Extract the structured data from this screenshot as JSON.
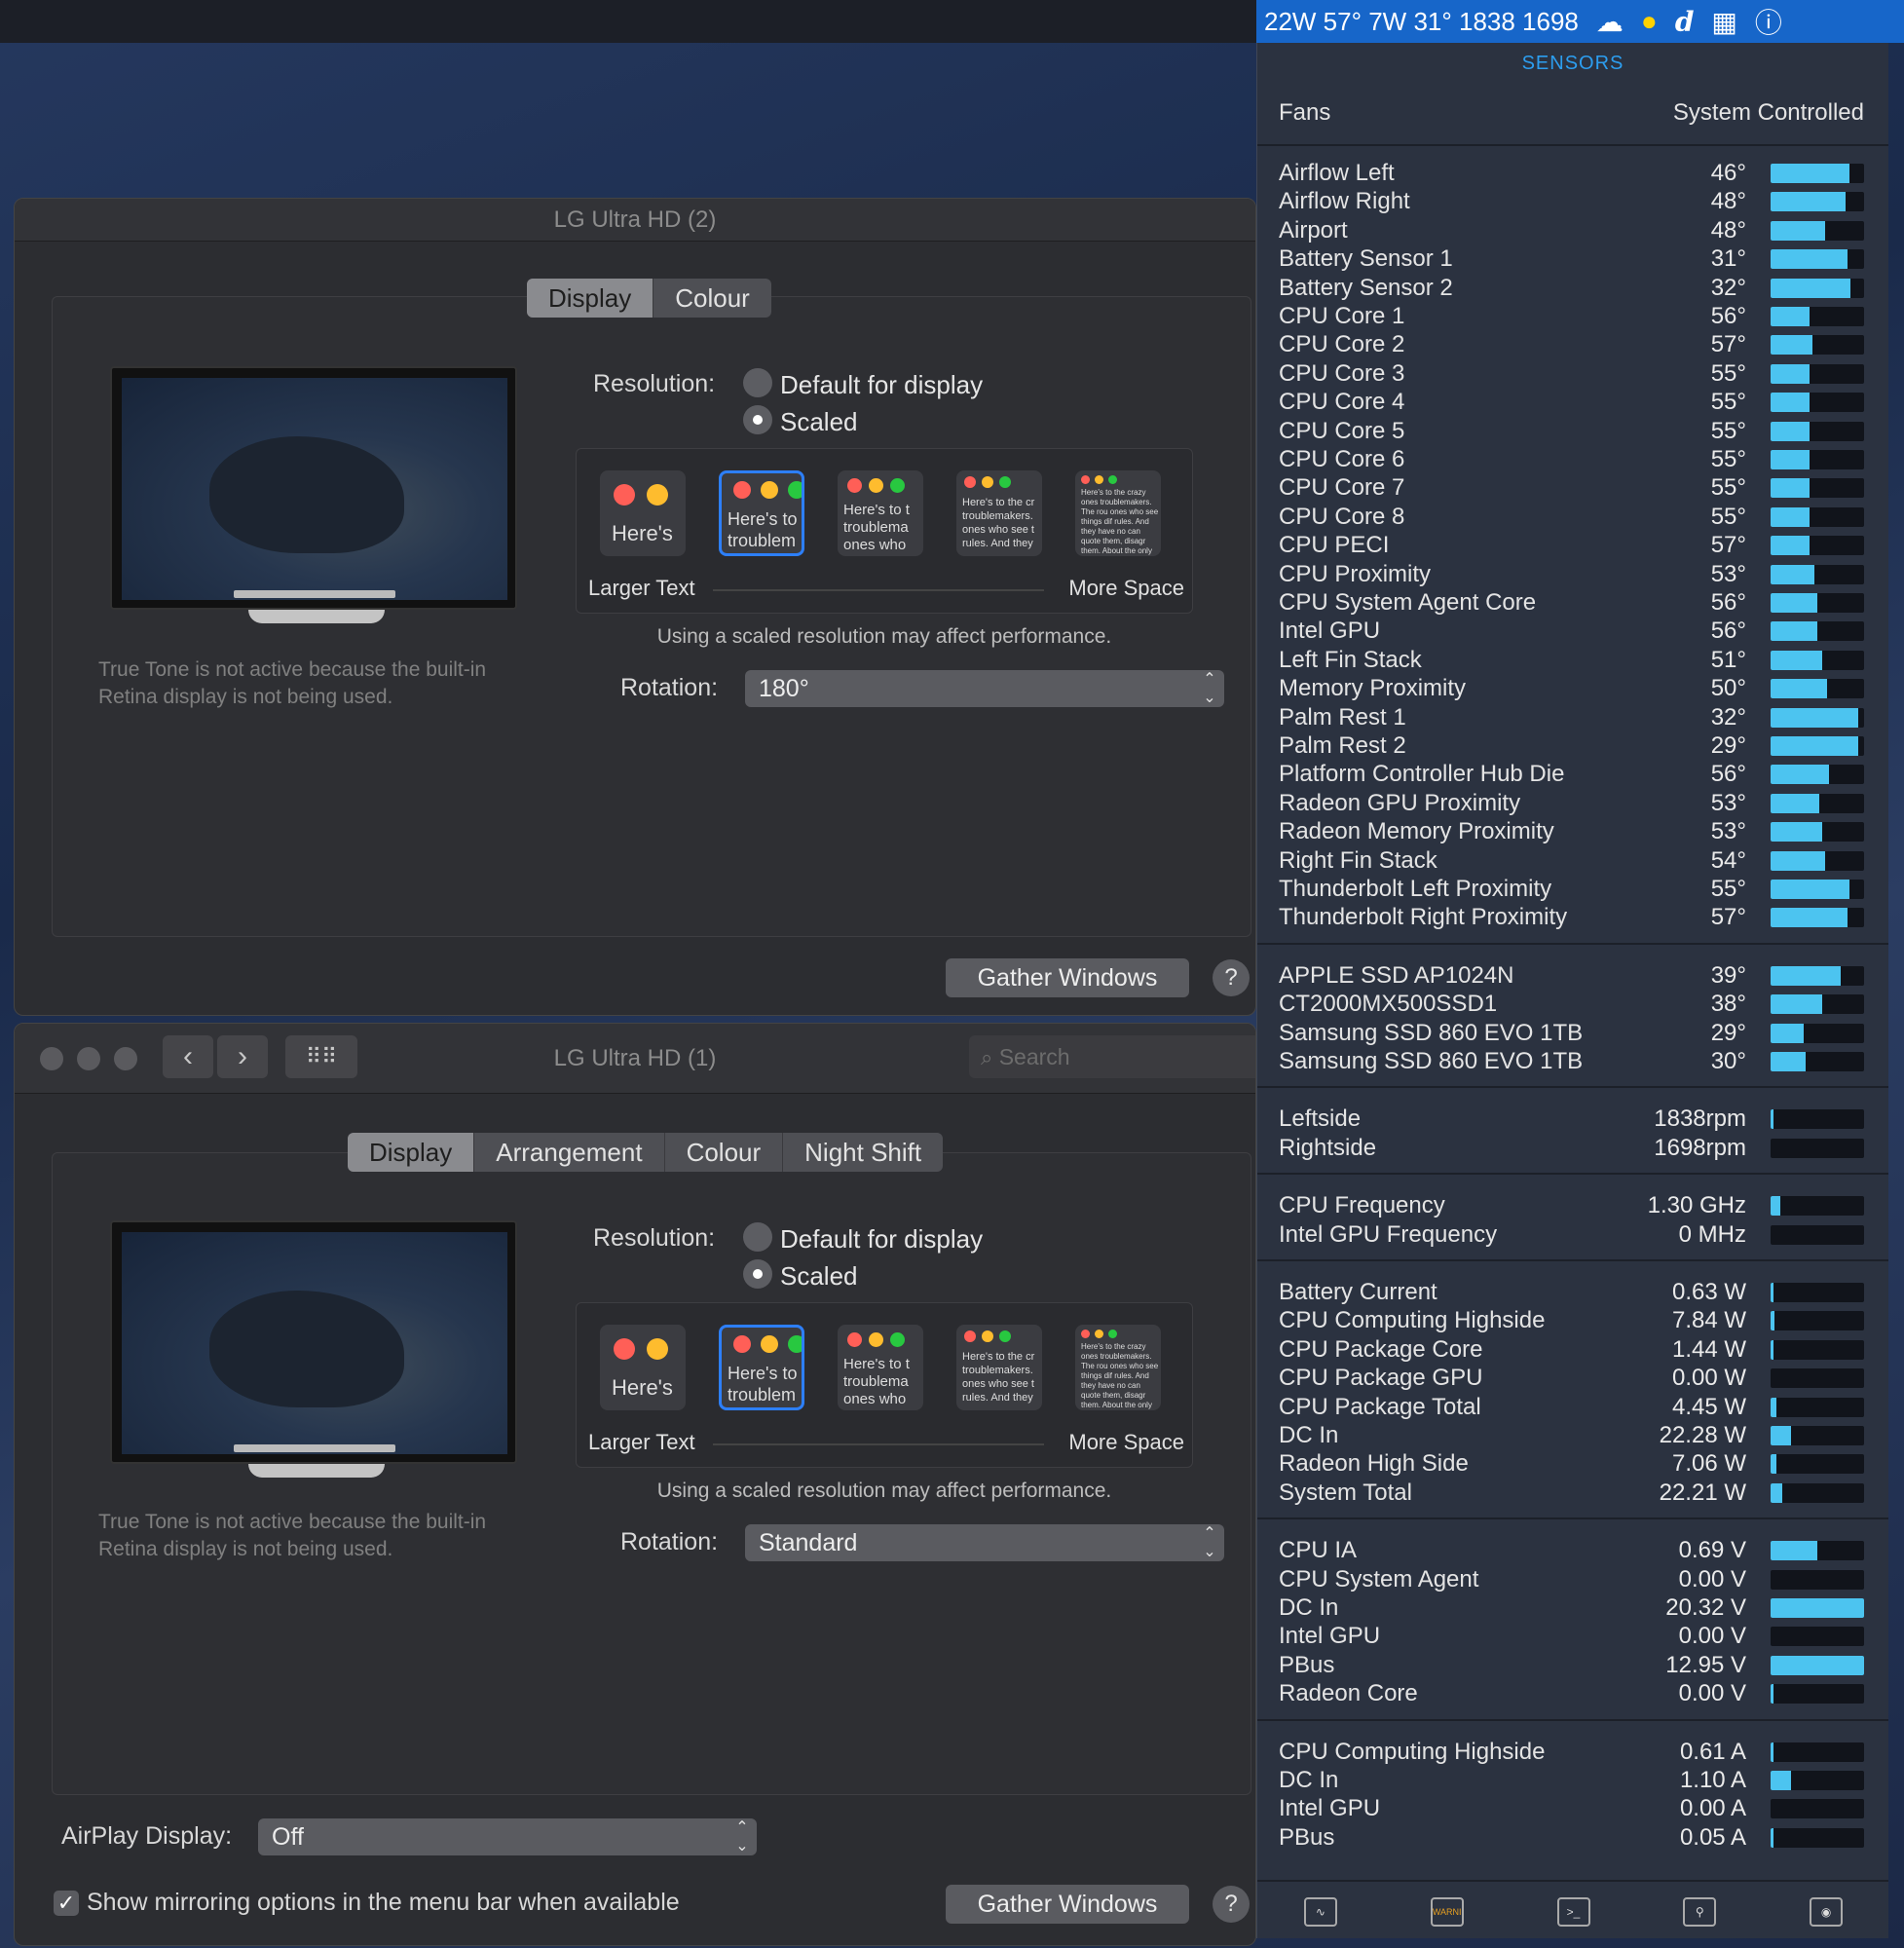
{
  "menubar": {
    "status_text": "22W 57° 7W   31° 1838 1698",
    "icons": [
      "cloud-icon",
      "yellow-circle-icon",
      "dictionary-icon",
      "grid-icon",
      "bolt-icon"
    ]
  },
  "win2": {
    "title": "LG Ultra HD (2)",
    "tabs": [
      {
        "label": "Display",
        "selected": true
      },
      {
        "label": "Colour",
        "selected": false
      }
    ],
    "resolution_label": "Resolution:",
    "option_default": "Default for display",
    "option_scaled": "Scaled",
    "thumb_texts": [
      "Here's",
      "Here's to troublem",
      "Here's to t troublema ones who",
      "Here's to the cr troublemakers. ones who see t rules. And they",
      "Here's to the crazy ones troublemakers. The rou ones who see things dif rules. And they have no can quote them, disagr them. About the only th Because they change it"
    ],
    "larger_text": "Larger Text",
    "more_space": "More Space",
    "performance_note": "Using a scaled resolution may affect performance.",
    "rotation_label": "Rotation:",
    "rotation_value": "180°",
    "truetone_note": "True Tone is not active because the built-in Retina display is not being used.",
    "gather_button": "Gather Windows",
    "help": "?"
  },
  "win1": {
    "title": "LG Ultra HD (1)",
    "search_placeholder": "Search",
    "tabs": [
      {
        "label": "Display",
        "selected": true
      },
      {
        "label": "Arrangement",
        "selected": false
      },
      {
        "label": "Colour",
        "selected": false
      },
      {
        "label": "Night Shift",
        "selected": false
      }
    ],
    "resolution_label": "Resolution:",
    "option_default": "Default for display",
    "option_scaled": "Scaled",
    "thumb_texts": [
      "Here's",
      "Here's to troublem",
      "Here's to t troublema ones who",
      "Here's to the cr troublemakers. ones who see t rules. And they",
      "Here's to the crazy ones troublemakers. The rou ones who see things dif rules. And they have no can quote them, disagr them. About the only th Because they change it"
    ],
    "larger_text": "Larger Text",
    "more_space": "More Space",
    "performance_note": "Using a scaled resolution may affect performance.",
    "rotation_label": "Rotation:",
    "rotation_value": "Standard",
    "truetone_note": "True Tone is not active because the built-in Retina display is not being used.",
    "airplay_label": "AirPlay Display:",
    "airplay_value": "Off",
    "mirror_option": "Show mirroring options in the menu bar when available",
    "mirror_checked": true,
    "gather_button": "Gather Windows",
    "help": "?"
  },
  "sensors": {
    "title": "SENSORS",
    "fans_label": "Fans",
    "fans_mode": "System Controlled",
    "accent_color": "#4cc4f0",
    "groups": [
      [
        {
          "name": "Airflow Left",
          "value": "46°",
          "level": 0.84
        },
        {
          "name": "Airflow Right",
          "value": "48°",
          "level": 0.8
        },
        {
          "name": "Airport",
          "value": "48°",
          "level": 0.58
        },
        {
          "name": "Battery Sensor 1",
          "value": "31°",
          "level": 0.82
        },
        {
          "name": "Battery Sensor 2",
          "value": "32°",
          "level": 0.85
        },
        {
          "name": "CPU Core 1",
          "value": "56°",
          "level": 0.42
        },
        {
          "name": "CPU Core 2",
          "value": "57°",
          "level": 0.45
        },
        {
          "name": "CPU Core 3",
          "value": "55°",
          "level": 0.42
        },
        {
          "name": "CPU Core 4",
          "value": "55°",
          "level": 0.42
        },
        {
          "name": "CPU Core 5",
          "value": "55°",
          "level": 0.42
        },
        {
          "name": "CPU Core 6",
          "value": "55°",
          "level": 0.42
        },
        {
          "name": "CPU Core 7",
          "value": "55°",
          "level": 0.42
        },
        {
          "name": "CPU Core 8",
          "value": "55°",
          "level": 0.42
        },
        {
          "name": "CPU PECI",
          "value": "57°",
          "level": 0.42
        },
        {
          "name": "CPU Proximity",
          "value": "53°",
          "level": 0.47
        },
        {
          "name": "CPU System Agent Core",
          "value": "56°",
          "level": 0.5
        },
        {
          "name": "Intel GPU",
          "value": "56°",
          "level": 0.5
        },
        {
          "name": "Left Fin Stack",
          "value": "51°",
          "level": 0.55
        },
        {
          "name": "Memory Proximity",
          "value": "50°",
          "level": 0.6
        },
        {
          "name": "Palm Rest 1",
          "value": "32°",
          "level": 0.94
        },
        {
          "name": "Palm Rest 2",
          "value": "29°",
          "level": 0.94
        },
        {
          "name": "Platform Controller Hub Die",
          "value": "56°",
          "level": 0.62
        },
        {
          "name": "Radeon GPU Proximity",
          "value": "53°",
          "level": 0.52
        },
        {
          "name": "Radeon Memory Proximity",
          "value": "53°",
          "level": 0.55
        },
        {
          "name": "Right Fin Stack",
          "value": "54°",
          "level": 0.58
        },
        {
          "name": "Thunderbolt Left Proximity",
          "value": "55°",
          "level": 0.84
        },
        {
          "name": "Thunderbolt Right Proximity",
          "value": "57°",
          "level": 0.82
        }
      ],
      [
        {
          "name": "APPLE SSD AP1024N",
          "value": "39°",
          "level": 0.75
        },
        {
          "name": "CT2000MX500SSD1",
          "value": "38°",
          "level": 0.55
        },
        {
          "name": "Samsung SSD 860 EVO 1TB",
          "value": "29°",
          "level": 0.35
        },
        {
          "name": "Samsung SSD 860 EVO 1TB",
          "value": "30°",
          "level": 0.37
        }
      ],
      [
        {
          "name": "Leftside",
          "value": "1838rpm",
          "level": 0.03
        },
        {
          "name": "Rightside",
          "value": "1698rpm",
          "level": 0.0
        }
      ],
      [
        {
          "name": "CPU Frequency",
          "value": "1.30 GHz",
          "level": 0.1
        },
        {
          "name": "Intel GPU Frequency",
          "value": "0 MHz",
          "level": 0.0
        }
      ],
      [
        {
          "name": "Battery Current",
          "value": "0.63 W",
          "level": 0.02
        },
        {
          "name": "CPU Computing Highside",
          "value": "7.84 W",
          "level": 0.04
        },
        {
          "name": "CPU Package Core",
          "value": "1.44 W",
          "level": 0.02
        },
        {
          "name": "CPU Package GPU",
          "value": "0.00 W",
          "level": 0.0
        },
        {
          "name": "CPU Package Total",
          "value": "4.45 W",
          "level": 0.06
        },
        {
          "name": "DC In",
          "value": "22.28 W",
          "level": 0.22
        },
        {
          "name": "Radeon High Side",
          "value": "7.06 W",
          "level": 0.06
        },
        {
          "name": "System Total",
          "value": "22.21 W",
          "level": 0.12
        }
      ],
      [
        {
          "name": "CPU IA",
          "value": "0.69 V",
          "level": 0.5
        },
        {
          "name": "CPU System Agent",
          "value": "0.00 V",
          "level": 0.0
        },
        {
          "name": "DC In",
          "value": "20.32 V",
          "level": 1.0
        },
        {
          "name": "Intel GPU",
          "value": "0.00 V",
          "level": 0.0
        },
        {
          "name": "PBus",
          "value": "12.95 V",
          "level": 1.0
        },
        {
          "name": "Radeon Core",
          "value": "0.00 V",
          "level": 0.02
        }
      ],
      [
        {
          "name": "CPU Computing Highside",
          "value": "0.61 A",
          "level": 0.02
        },
        {
          "name": "DC In",
          "value": "1.10 A",
          "level": 0.22
        },
        {
          "name": "Intel GPU",
          "value": "0.00 A",
          "level": 0.0
        },
        {
          "name": "PBus",
          "value": "0.05 A",
          "level": 0.02
        }
      ]
    ],
    "footer_icons": [
      {
        "name": "activity-monitor-icon",
        "glyph": "∿"
      },
      {
        "name": "console-icon",
        "glyph": "WARNI"
      },
      {
        "name": "terminal-icon",
        "glyph": ">_"
      },
      {
        "name": "keychain-icon",
        "glyph": "⚲"
      },
      {
        "name": "istat-icon",
        "glyph": "◉"
      }
    ]
  }
}
